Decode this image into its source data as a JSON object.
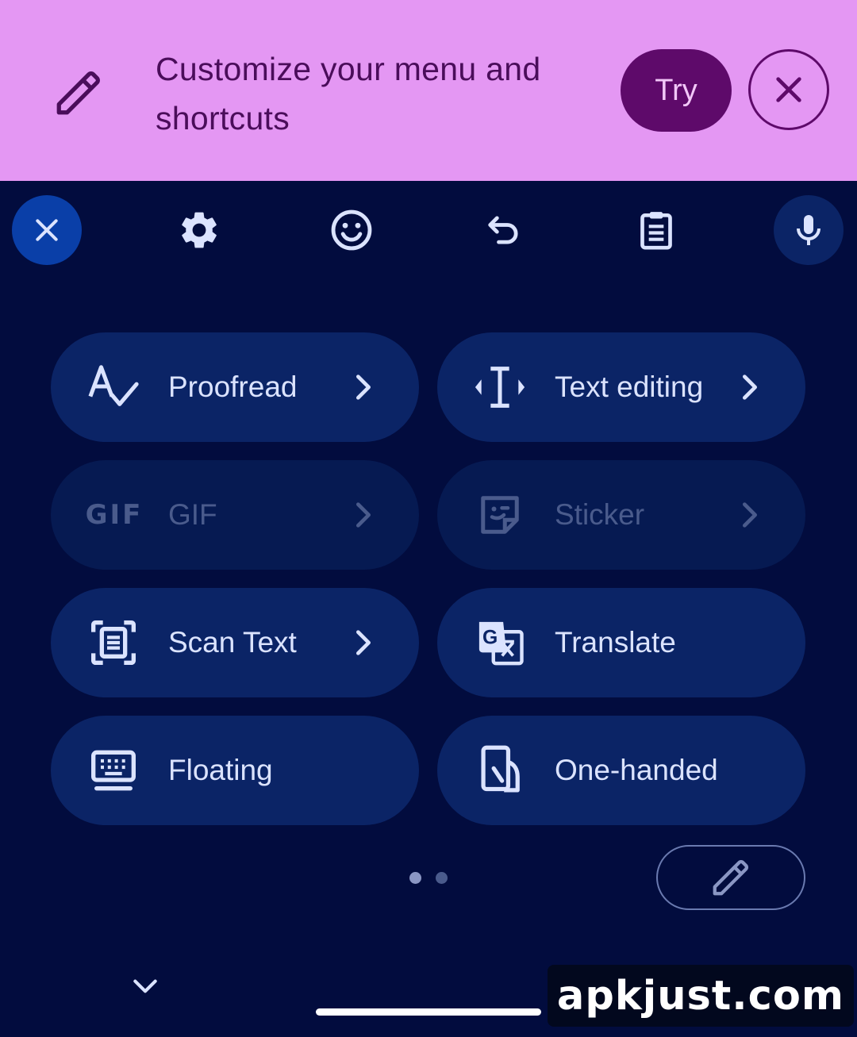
{
  "banner": {
    "message": "Customize your menu and shortcuts",
    "try_label": "Try",
    "icon": "pencil-icon",
    "close_icon": "close-icon"
  },
  "toolbar": {
    "items": [
      "close-icon",
      "settings-icon",
      "emoji-icon",
      "undo-icon",
      "clipboard-icon",
      "mic-icon"
    ]
  },
  "tiles": [
    {
      "label": "Proofread",
      "icon": "proofread-icon",
      "has_chevron": true,
      "enabled": true
    },
    {
      "label": "Text editing",
      "icon": "text-cursor-icon",
      "has_chevron": true,
      "enabled": true
    },
    {
      "label": "GIF",
      "icon": "gif-icon",
      "icon_text": "GIF",
      "has_chevron": true,
      "enabled": false
    },
    {
      "label": "Sticker",
      "icon": "sticker-icon",
      "has_chevron": true,
      "enabled": false
    },
    {
      "label": "Scan Text",
      "icon": "scan-text-icon",
      "has_chevron": true,
      "enabled": true
    },
    {
      "label": "Translate",
      "icon": "translate-icon",
      "has_chevron": false,
      "enabled": true
    },
    {
      "label": "Floating",
      "icon": "floating-keyboard-icon",
      "has_chevron": false,
      "enabled": true
    },
    {
      "label": "One-handed",
      "icon": "one-handed-icon",
      "has_chevron": false,
      "enabled": true
    }
  ],
  "pager": {
    "pages": 2,
    "current": 1
  },
  "watermark": "apkjust.com",
  "colors": {
    "banner_bg": "#e497f3",
    "banner_text": "#4a0d5a",
    "try_bg": "#5e0a6a",
    "keyboard_bg": "#020c3e",
    "tile_bg": "#0b2466",
    "close_btn_bg": "#0a3fa8",
    "mic_btn_bg": "#0b2466"
  }
}
